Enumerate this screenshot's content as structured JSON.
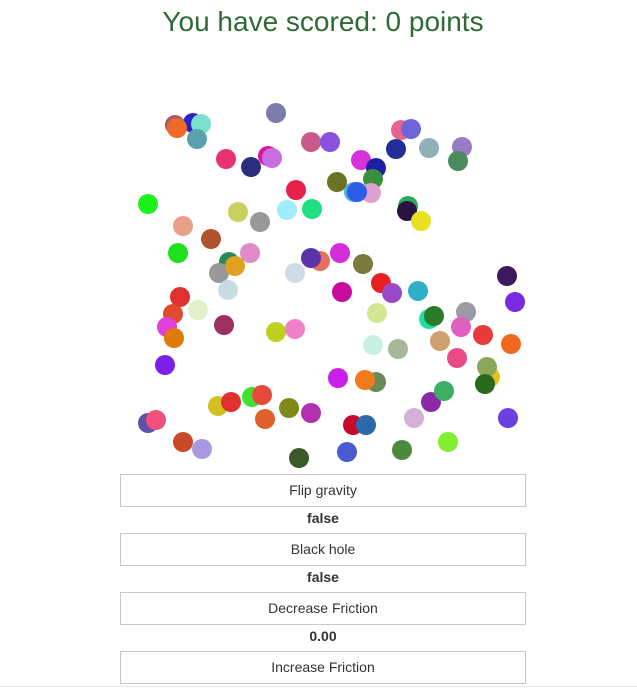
{
  "score_text": "You have scored: 0 points",
  "controls": {
    "flip_gravity": {
      "label": "Flip gravity",
      "value": "false"
    },
    "black_hole": {
      "label": "Black hole",
      "value": "false"
    },
    "decrease_friction": {
      "label": "Decrease Friction"
    },
    "friction": {
      "value": "0.00"
    },
    "increase_friction": {
      "label": "Increase Friction"
    }
  },
  "colors": {
    "score_text": "#2e6b34",
    "button_border": "#c8c8c8"
  },
  "balls": [
    {
      "color": "#7f7bab"
    },
    {
      "color": "#a85a6a"
    },
    {
      "color": "#2a25c8"
    },
    {
      "color": "#79e0cc"
    },
    {
      "color": "#ef6a26"
    },
    {
      "color": "#5aa0ad"
    },
    {
      "color": "#c85a8a"
    },
    {
      "color": "#8a50e0"
    },
    {
      "color": "#e8648c"
    },
    {
      "color": "#6e66d8"
    },
    {
      "color": "#e8336e"
    },
    {
      "color": "#2b2e7a"
    },
    {
      "color": "#d916a0"
    },
    {
      "color": "#c86ee0"
    },
    {
      "color": "#232f96"
    },
    {
      "color": "#8fb0b7"
    },
    {
      "color": "#9a7bc5"
    },
    {
      "color": "#4b8a5e"
    },
    {
      "color": "#d931d9"
    },
    {
      "color": "#1e1fa8"
    },
    {
      "color": "#3a8f3a"
    },
    {
      "color": "#6b7322"
    },
    {
      "color": "#e6224c"
    },
    {
      "color": "#e0a0d0"
    },
    {
      "color": "#4ab0e0"
    },
    {
      "color": "#2b5de8"
    },
    {
      "color": "#2aad5a"
    },
    {
      "color": "#2a1240"
    },
    {
      "color": "#e8e020"
    },
    {
      "color": "#1ef01e"
    },
    {
      "color": "#c8d060"
    },
    {
      "color": "#999999"
    },
    {
      "color": "#a0ecf8"
    },
    {
      "color": "#1ee080"
    },
    {
      "color": "#e8a08a"
    },
    {
      "color": "#b0522a"
    },
    {
      "color": "#1ee01e"
    },
    {
      "color": "#e08ac8"
    },
    {
      "color": "#2a8a5a"
    },
    {
      "color": "#999999"
    },
    {
      "color": "#e0a020"
    },
    {
      "color": "#c8dce6"
    },
    {
      "color": "#ccdce8"
    },
    {
      "color": "#e8705a"
    },
    {
      "color": "#5a34a6"
    },
    {
      "color": "#d32ed9"
    },
    {
      "color": "#c80aa0"
    },
    {
      "color": "#7a7a3a"
    },
    {
      "color": "#e82020"
    },
    {
      "color": "#9a4ac8"
    },
    {
      "color": "#30b0c8"
    },
    {
      "color": "#3a1a5a"
    },
    {
      "color": "#7a2ae0"
    },
    {
      "color": "#e03030"
    },
    {
      "color": "#e04a30"
    },
    {
      "color": "#e0f0c8"
    },
    {
      "color": "#e040e0"
    },
    {
      "color": "#e07a0a"
    },
    {
      "color": "#9e3060"
    },
    {
      "color": "#c0d020"
    },
    {
      "color": "#f080c8"
    },
    {
      "color": "#d0e890"
    },
    {
      "color": "#1ee0a0"
    },
    {
      "color": "#2a7a2a"
    },
    {
      "color": "#9a9aa8"
    },
    {
      "color": "#e060c0"
    },
    {
      "color": "#e83a3a"
    },
    {
      "color": "#f06a1e"
    },
    {
      "color": "#c8f0e0"
    },
    {
      "color": "#a8b896"
    },
    {
      "color": "#d0a070"
    },
    {
      "color": "#e84a8a"
    },
    {
      "color": "#7a20e8"
    },
    {
      "color": "#e8c020"
    },
    {
      "color": "#8aa85a"
    },
    {
      "color": "#2a6a1a"
    },
    {
      "color": "#c820e8"
    },
    {
      "color": "#6a8a5a"
    },
    {
      "color": "#f07a1e"
    },
    {
      "color": "#8a2aa8"
    },
    {
      "color": "#3ab060"
    },
    {
      "color": "#d0c020"
    },
    {
      "color": "#e03030"
    },
    {
      "color": "#40e030"
    },
    {
      "color": "#e84a3a"
    },
    {
      "color": "#808a1a"
    },
    {
      "color": "#b030b0"
    },
    {
      "color": "#e0602a"
    },
    {
      "color": "#c80a2a"
    },
    {
      "color": "#2a6aa8"
    },
    {
      "color": "#d4b0d8"
    },
    {
      "color": "#6a40e0"
    },
    {
      "color": "#6050a8"
    },
    {
      "color": "#f0507a"
    },
    {
      "color": "#c84a2a"
    },
    {
      "color": "#a898e0"
    },
    {
      "color": "#3a5a2a"
    },
    {
      "color": "#4a5ad0"
    },
    {
      "color": "#4a8a3a"
    },
    {
      "color": "#80f030"
    }
  ]
}
